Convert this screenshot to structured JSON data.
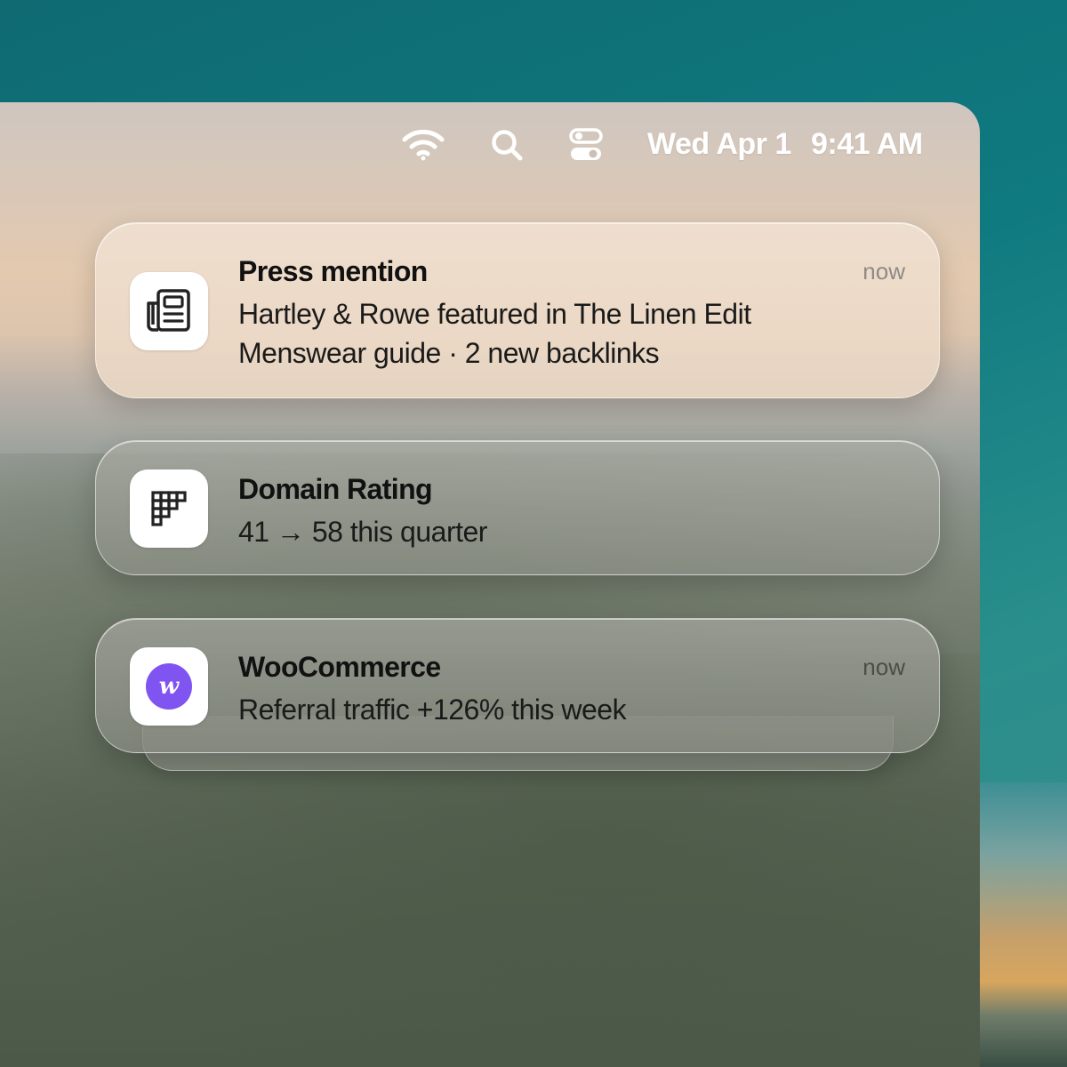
{
  "menubar": {
    "date": "Wed Apr 1",
    "time": "9:41 AM",
    "icons": [
      "wifi-icon",
      "search-icon",
      "control-center-icon"
    ]
  },
  "notifications": [
    {
      "app_icon": "newspaper-icon",
      "title": "Press mention",
      "body_line1": "Hartley & Rowe featured in The Linen Edit",
      "body_line2": "Menswear guide · 2 new backlinks",
      "time": "now"
    },
    {
      "app_icon": "grid-chart-icon",
      "title": "Domain Rating",
      "body_line1": "41 → 58 this quarter"
    },
    {
      "app_icon": "webflow-icon",
      "app_icon_letter": "w",
      "title": "WooCommerce",
      "body_line1": "Referral traffic +126% this week",
      "time": "now"
    }
  ],
  "colors": {
    "webflow_purple": "#7f54f0",
    "desktop_teal": "#0f7a80"
  }
}
